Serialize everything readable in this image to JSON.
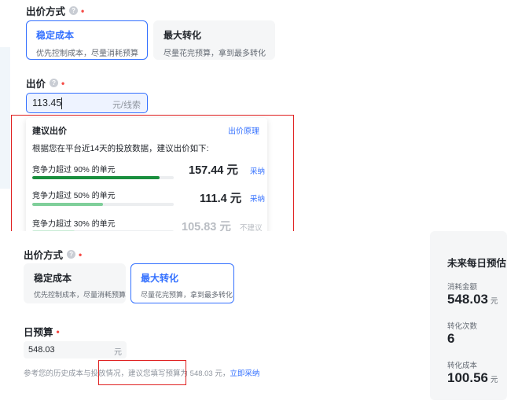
{
  "bid_method": {
    "label": "出价方式",
    "help_icon": "question-circle-icon",
    "required_mark": "•",
    "options": [
      {
        "title": "稳定成本",
        "desc": "优先控制成本，尽量消耗预算"
      },
      {
        "title": "最大转化",
        "desc": "尽量花完预算，拿到最多转化"
      }
    ],
    "selected": "稳定成本"
  },
  "bid": {
    "label": "出价",
    "required_mark": "•",
    "value": "113.45",
    "unit": "元/线索"
  },
  "suggestion": {
    "title": "建议出价",
    "link": "出价原理",
    "description": "根据您在平台近14天的投放数据，建议出价如下:",
    "tiers": [
      {
        "label": "竞争力超过 90% 的单元",
        "price": "157.44 元",
        "action": "采纳",
        "level": 0.9,
        "color": "#1a8f3e"
      },
      {
        "label": "竞争力超过 50% 的单元",
        "price": "111.4 元",
        "action": "采纳",
        "level": 0.5,
        "color": "#7fcf9a"
      },
      {
        "label": "竞争力超过 30% 的单元",
        "price": "105.83 元",
        "action": "不建议",
        "level": 0.3,
        "color": "#c5ebd2"
      }
    ]
  },
  "bid_method_2": {
    "label": "出价方式",
    "required_mark": "•",
    "options": [
      {
        "title": "稳定成本",
        "desc": "优先控制成本，尽量消耗预算"
      },
      {
        "title": "最大转化",
        "desc": "尽量花完预算，拿到最多转化"
      }
    ],
    "selected": "最大转化"
  },
  "daily_budget": {
    "label": "日预算",
    "required_mark": "•",
    "value": "548.03",
    "unit": "元",
    "hint_prefix": "参考您的历史成本与投放情况，",
    "hint_suggest": "建议您填写预算为 548.03 元，",
    "hint_action": "立即采纳"
  },
  "forecast": {
    "title": "未来每日预估",
    "items": [
      {
        "label": "消耗金额",
        "value": "548.03",
        "unit": "元"
      },
      {
        "label": "转化次数",
        "value": "6",
        "unit": ""
      },
      {
        "label": "转化成本",
        "value": "100.56",
        "unit": "元"
      }
    ]
  },
  "colors": {
    "accent": "#3370ff",
    "required": "#f54a45",
    "highlight_border": "#e02020"
  }
}
